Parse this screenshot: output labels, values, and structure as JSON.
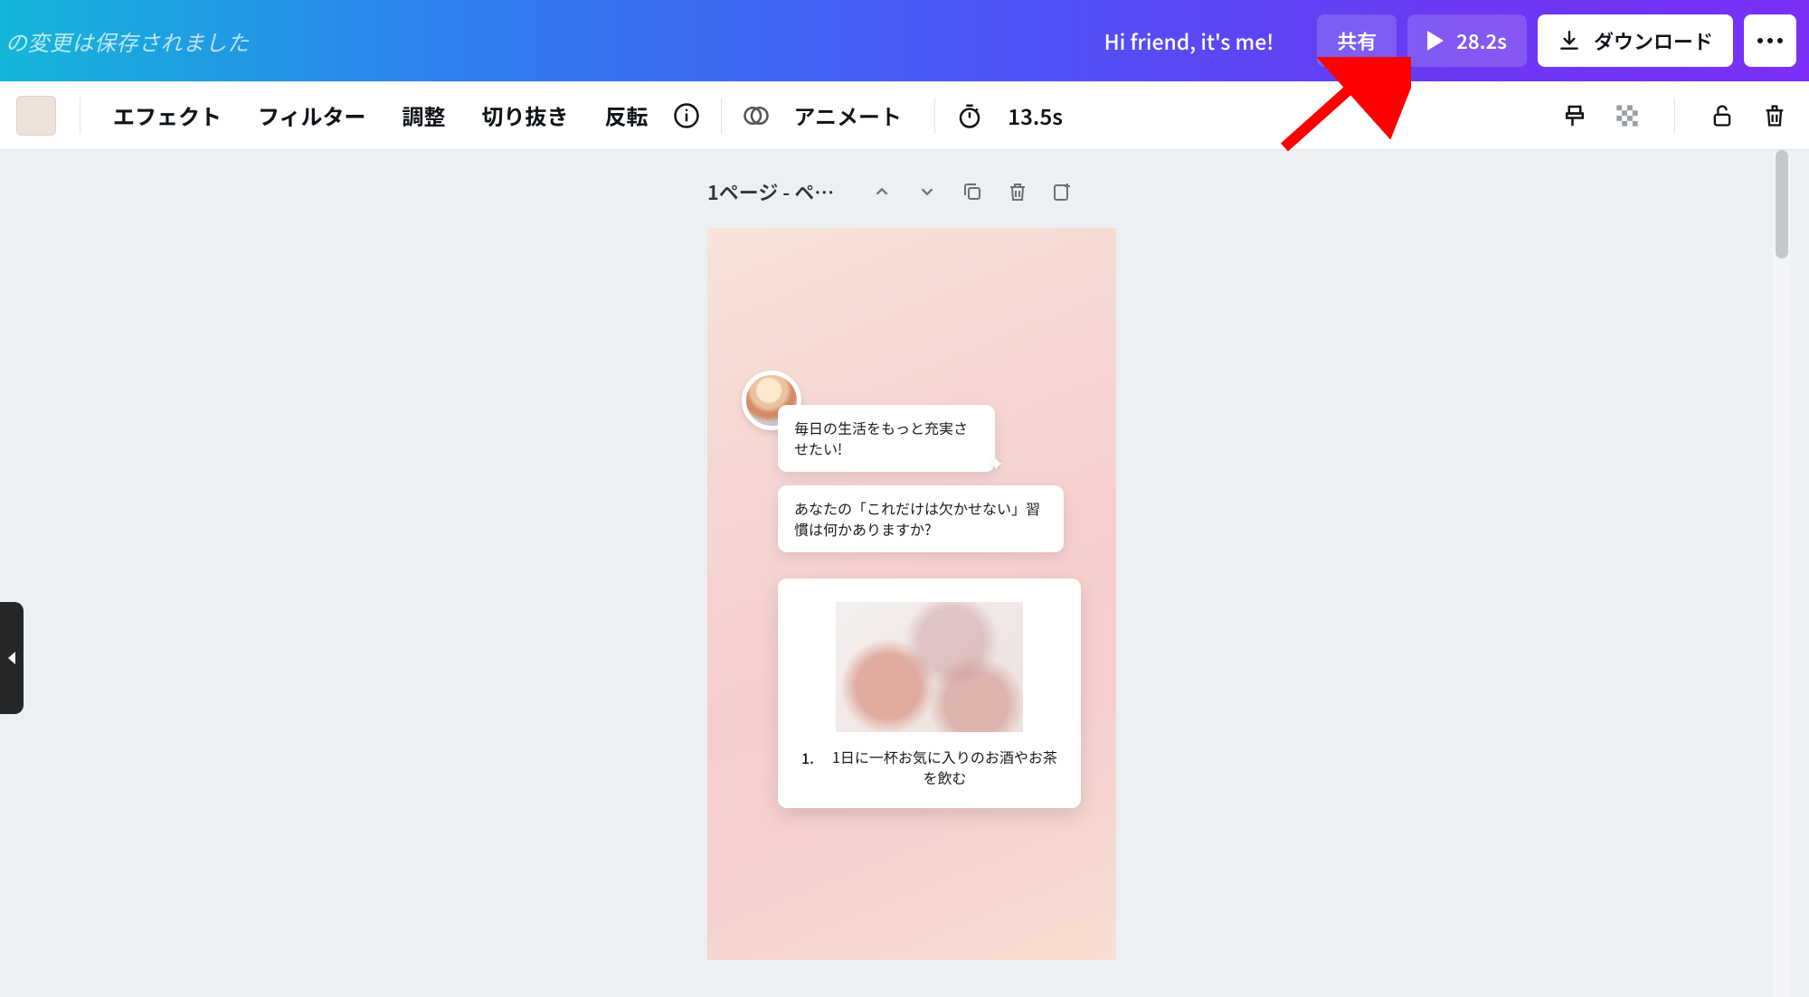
{
  "header": {
    "saved_message": "の変更は保存されました",
    "greeting": "Hi friend, it's me!",
    "share_label": "共有",
    "play_duration": "28.2s",
    "download_label": "ダウンロード"
  },
  "toolbar": {
    "swatch_color": "#efe2d9",
    "effects": "エフェクト",
    "filter": "フィルター",
    "adjust": "調整",
    "crop": "切り抜き",
    "flip": "反転",
    "animate": "アニメート",
    "timing": "13.5s"
  },
  "page_controls": {
    "label": "1ページ - ペー..."
  },
  "canvas": {
    "bubble1": "毎日の生活をもっと充実させたい!",
    "bubble2": "あなたの「これだけは欠かせない」習慣は何かありますか?",
    "card_number": "1.",
    "card_text": "1日に一杯お気に入りのお酒やお茶を飲む"
  },
  "annotation": {
    "arrow_target": "play-button"
  }
}
